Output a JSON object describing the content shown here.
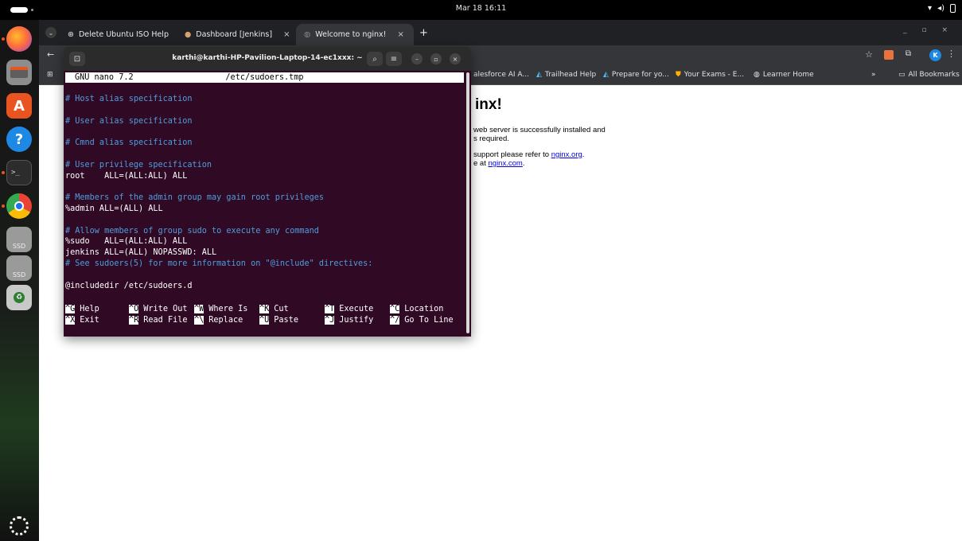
{
  "topbar": {
    "clock": "Mar 18 16:11"
  },
  "dock": {
    "items": [
      {
        "name": "firefox",
        "running": true
      },
      {
        "name": "files",
        "running": false
      },
      {
        "name": "app-center",
        "running": false
      },
      {
        "name": "help",
        "running": false
      },
      {
        "name": "terminal",
        "running": true
      },
      {
        "name": "chrome",
        "running": true
      },
      {
        "name": "ssd-drive-1",
        "label": "SSD"
      },
      {
        "name": "ssd-drive-2",
        "label": "SSD"
      },
      {
        "name": "trash",
        "running": false
      }
    ]
  },
  "browser": {
    "tabs": [
      {
        "label": "Delete Ubuntu ISO Help",
        "active": false
      },
      {
        "label": "Dashboard [Jenkins]",
        "active": false
      },
      {
        "label": "Welcome to nginx!",
        "active": true
      }
    ],
    "new_tab_label": "+",
    "bookmarks": [
      {
        "label": "alesforce AI A..."
      },
      {
        "label": "Trailhead Help"
      },
      {
        "label": "Prepare for yo..."
      },
      {
        "label": "Your Exams - E..."
      },
      {
        "label": "Learner Home"
      }
    ],
    "bookmarks_overflow": "»",
    "all_bookmarks_label": "All Bookmarks",
    "profile_initial": "K",
    "page": {
      "heading": "inx!",
      "line1": "web server is successfully installed and",
      "line2": "s required.",
      "line3_prefix": "support please refer to ",
      "line3_link": "nginx.org",
      "line3_suffix": ".",
      "line4_prefix": "e at ",
      "line4_link": "nginx.com",
      "line4_suffix": "."
    }
  },
  "terminal": {
    "title": "karthi@karthi-HP-Pavilion-Laptop-14-ec1xxx: ~",
    "nano": {
      "version": "GNU nano 7.2",
      "filename": "/etc/sudoers.tmp",
      "lines": [
        {
          "text": "# Host alias specification",
          "comment": true
        },
        {
          "text": "",
          "comment": false
        },
        {
          "text": "# User alias specification",
          "comment": true
        },
        {
          "text": "",
          "comment": false
        },
        {
          "text": "# Cmnd alias specification",
          "comment": true
        },
        {
          "text": "",
          "comment": false
        },
        {
          "text": "# User privilege specification",
          "comment": true
        },
        {
          "text": "root    ALL=(ALL:ALL) ALL",
          "comment": false
        },
        {
          "text": "",
          "comment": false
        },
        {
          "text": "# Members of the admin group may gain root privileges",
          "comment": true
        },
        {
          "text": "%admin ALL=(ALL) ALL",
          "comment": false
        },
        {
          "text": "",
          "comment": false
        },
        {
          "text": "# Allow members of group sudo to execute any command",
          "comment": true
        },
        {
          "text": "%sudo   ALL=(ALL:ALL) ALL",
          "comment": false
        },
        {
          "text": "jenkins ALL=(ALL) NOPASSWD: ALL",
          "comment": false
        },
        {
          "text": "# See sudoers(5) for more information on \"@include\" directives:",
          "comment": true
        },
        {
          "text": "",
          "comment": false
        },
        {
          "text": "@includedir /etc/sudoers.d",
          "comment": false
        }
      ],
      "shortcuts_row1": [
        {
          "key": "^G",
          "label": "Help"
        },
        {
          "key": "^O",
          "label": "Write Out"
        },
        {
          "key": "^W",
          "label": "Where Is"
        },
        {
          "key": "^K",
          "label": "Cut"
        },
        {
          "key": "^T",
          "label": "Execute"
        },
        {
          "key": "^C",
          "label": "Location"
        }
      ],
      "shortcuts_row2": [
        {
          "key": "^X",
          "label": "Exit"
        },
        {
          "key": "^R",
          "label": "Read File"
        },
        {
          "key": "^\\",
          "label": "Replace"
        },
        {
          "key": "^U",
          "label": "Paste"
        },
        {
          "key": "^J",
          "label": "Justify"
        },
        {
          "key": "^/",
          "label": "Go To Line"
        }
      ]
    }
  },
  "colors": {
    "terminal_bg": "#300a24",
    "comment": "#4f9ddc",
    "ubuntu_orange": "#e95420",
    "link": "#0000ee"
  }
}
